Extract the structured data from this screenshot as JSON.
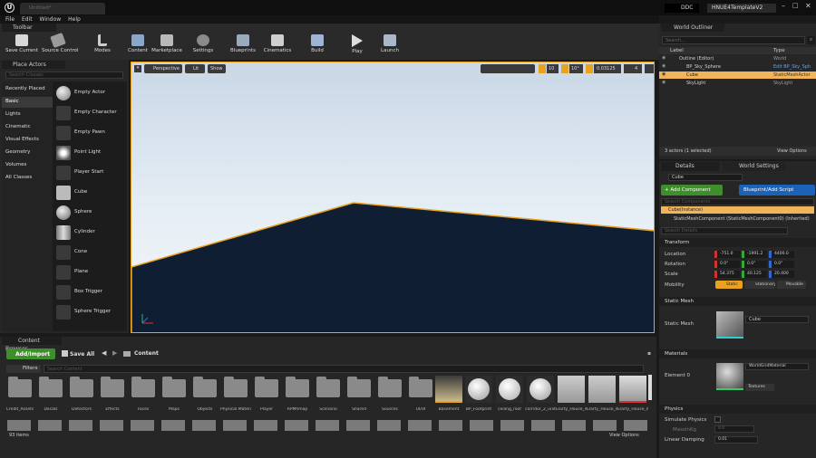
{
  "title_bar": {
    "tab": "Untitled*",
    "source_control": "DDC",
    "project": "HNUE4TemplateV2"
  },
  "menu": [
    "File",
    "Edit",
    "Window",
    "Help"
  ],
  "toolbar": {
    "tab_label": "Toolbar",
    "buttons": [
      "Save Current",
      "Source Control",
      "Modes",
      "Content",
      "Marketplace",
      "Settings",
      "Blueprints",
      "Cinematics",
      "Build",
      "Play",
      "Launch"
    ]
  },
  "place_actors": {
    "tab_label": "Place Actors",
    "search_placeholder": "Search Classes",
    "categories": [
      "Recently Placed",
      "Basic",
      "Lights",
      "Cinematic",
      "Visual Effects",
      "Geometry",
      "Volumes",
      "All Classes"
    ],
    "items": [
      "Empty Actor",
      "Empty Character",
      "Empty Pawn",
      "Point Light",
      "Player Start",
      "Cube",
      "Sphere",
      "Cylinder",
      "Cone",
      "Plane",
      "Box Trigger",
      "Sphere Trigger"
    ]
  },
  "viewport": {
    "perspective": "Perspective",
    "lit": "Lit",
    "show": "Show",
    "grid_snap": "10",
    "rot_snap": "10°",
    "scale_snap": "0.03125",
    "cam_speed": "4"
  },
  "outliner": {
    "tab_label": "World Outliner",
    "search_placeholder": "Search...",
    "col_label": "Label",
    "col_type": "Type",
    "rows": [
      {
        "label": "Outline (Editor)",
        "type": "World"
      },
      {
        "label": "BP_Sky_Sphere",
        "type": "Edit BP_Sky_Sph"
      },
      {
        "label": "Cube",
        "type": "StaticMeshActor"
      },
      {
        "label": "SkyLight",
        "type": "SkyLight"
      }
    ],
    "status": "3 actors (1 selected)",
    "view_options": "View Options"
  },
  "details": {
    "tab_label": "Details",
    "tab2_label": "World Settings",
    "name_value": "Cube",
    "add_component": "+ Add Component",
    "blueprint": "Blueprint/Add Script",
    "search_components": "Search Components",
    "instance": "Cube(Instance)",
    "component": "StaticMeshComponent (StaticMeshComponent0) (Inherited)",
    "search_details": "Search Details",
    "transform_label": "Transform",
    "location_label": "Location",
    "rotation_label": "Rotation",
    "scale_label": "Scale",
    "mobility_label": "Mobility",
    "location": [
      "-751.0",
      "-1991.2",
      "4400.0"
    ],
    "rotation": [
      "0.0°",
      "0.0°",
      "0.0°"
    ],
    "scale": [
      "54.375",
      "40.125",
      "20.400"
    ],
    "mobility": [
      "Static",
      "Stationary",
      "Movable"
    ],
    "static_mesh_section": "Static Mesh",
    "static_mesh_label": "Static Mesh",
    "static_mesh_value": "Cube",
    "materials_section": "Materials",
    "element0": "Element 0",
    "material_value": "WorldGridMaterial",
    "textures": "Textures",
    "physics_section": "Physics",
    "simulate_physics": "Simulate Physics",
    "mass_label": "MassInKg",
    "mass_value": "0.0",
    "linear_damping_label": "Linear Damping",
    "linear_damping_value": "0.01"
  },
  "content_browser": {
    "tab_label": "Content Browser",
    "add_import": "Add/Import",
    "save_all": "Save All",
    "path": "Content",
    "filters": "Filters",
    "search_placeholder": "Search Content",
    "folders": [
      "Credit_Assets",
      "Decals",
      "Detectors",
      "Effects",
      "Faces",
      "Maps",
      "Objects",
      "Physical Material",
      "Player",
      "RPMhmap",
      "Scenario",
      "Shared",
      "Sources",
      "UI/UI"
    ],
    "assets": [
      "Basement",
      "BP_Footprint",
      "ceiling_roof",
      "corridor_2_unit",
      "Elarty_House_mmu_floor_1",
      "Elarty_House_mmp_floor_1_001",
      "Elarty_House_mmp_floor_1_001"
    ],
    "item_count": "93 items",
    "view_options": "View Options"
  },
  "colors": {
    "accent": "#e8a21f",
    "green": "#3e8e2c",
    "blue": "#1a63b8"
  }
}
